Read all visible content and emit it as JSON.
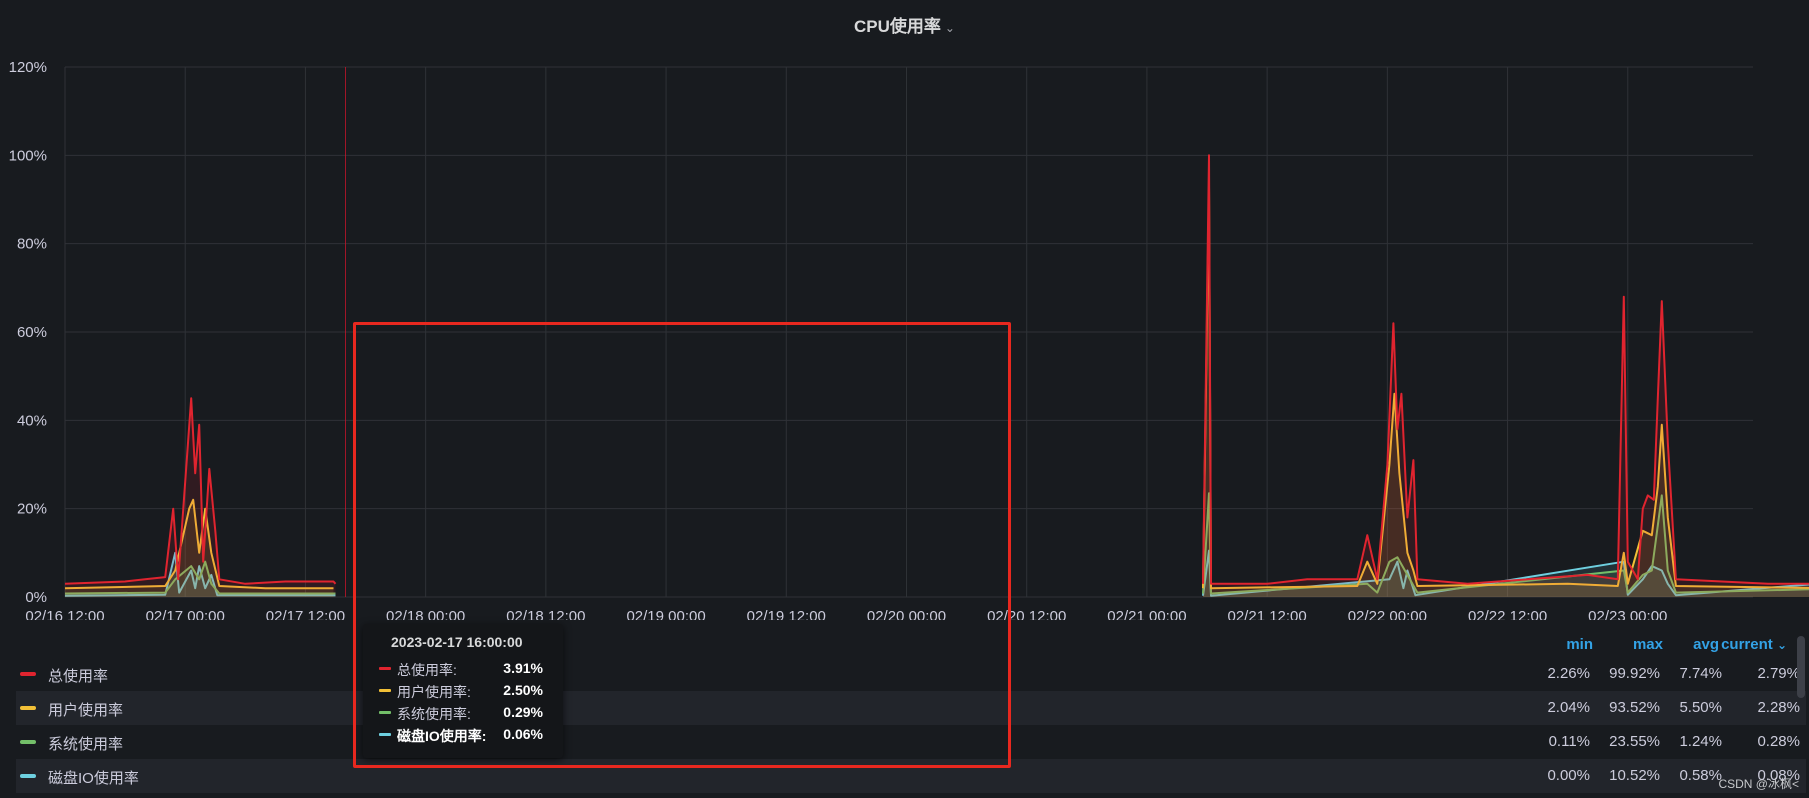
{
  "panel": {
    "title": "CPU使用率"
  },
  "colors": {
    "total": "#e0242f",
    "user": "#f2c037",
    "system": "#73bf69",
    "io": "#6ed0e0",
    "box": "#e8281f"
  },
  "icons": {
    "title_dropdown": "chevron-down-icon",
    "current_sort": "chevron-down-icon"
  },
  "legend": {
    "headers": {
      "min": "min",
      "max": "max",
      "avg": "avg",
      "current": "current"
    },
    "rows": [
      {
        "name": "总使用率",
        "min": "2.26%",
        "max": "99.92%",
        "avg": "7.74%",
        "current": "2.79%"
      },
      {
        "name": "用户使用率",
        "min": "2.04%",
        "max": "93.52%",
        "avg": "5.50%",
        "current": "2.28%"
      },
      {
        "name": "系统使用率",
        "min": "0.11%",
        "max": "23.55%",
        "avg": "1.24%",
        "current": "0.28%"
      },
      {
        "name": "磁盘IO使用率",
        "min": "0.00%",
        "max": "10.52%",
        "avg": "0.58%",
        "current": "0.08%"
      }
    ]
  },
  "tooltip": {
    "time": "2023-02-17 16:00:00",
    "rows": [
      {
        "name": "总使用率:",
        "value": "3.91%"
      },
      {
        "name": "用户使用率:",
        "value": "2.50%"
      },
      {
        "name": "系统使用率:",
        "value": "0.29%"
      },
      {
        "name": "磁盘IO使用率:",
        "value": "0.06%"
      }
    ]
  },
  "watermark": "CSDN @冰枫<",
  "chart_data": {
    "type": "line",
    "title": "CPU使用率",
    "xlabel": "",
    "ylabel": "",
    "ylim": [
      0,
      120
    ],
    "xlim": [
      "02/16 12:00",
      "02/23 12:00"
    ],
    "x_ticks": [
      "02/16 12:00",
      "02/17 00:00",
      "02/17 12:00",
      "02/18 00:00",
      "02/18 12:00",
      "02/19 00:00",
      "02/19 12:00",
      "02/20 00:00",
      "02/20 12:00",
      "02/21 00:00",
      "02/21 12:00",
      "02/22 00:00",
      "02/22 12:00",
      "02/23 00:00"
    ],
    "y_ticks": [
      "0%",
      "20%",
      "40%",
      "60%",
      "80%",
      "100%",
      "120%"
    ],
    "y_tick_values": [
      0,
      20,
      40,
      60,
      80,
      100,
      120
    ],
    "grid": true,
    "legend_placement": "bottom-table",
    "x_unit": "hours since 02/16 12:00",
    "series": [
      {
        "name": "总使用率",
        "points": [
          [
            0,
            3
          ],
          [
            6,
            3.5
          ],
          [
            8,
            4
          ],
          [
            10,
            4.5
          ],
          [
            10.8,
            20
          ],
          [
            11.3,
            4
          ],
          [
            12.6,
            45
          ],
          [
            13,
            28
          ],
          [
            13.4,
            39
          ],
          [
            13.8,
            8
          ],
          [
            14.4,
            29
          ],
          [
            15,
            15
          ],
          [
            15.4,
            4
          ],
          [
            18,
            3
          ],
          [
            22,
            3.5
          ],
          [
            26.8,
            3.5
          ],
          [
            27,
            3
          ],
          [
            27.3,
            null
          ],
          [
            113.5,
            null
          ],
          [
            113.6,
            3
          ],
          [
            114.2,
            100
          ],
          [
            114.4,
            3
          ],
          [
            120,
            3
          ],
          [
            124,
            4
          ],
          [
            129,
            4
          ],
          [
            130,
            14
          ],
          [
            131,
            4
          ],
          [
            132,
            30
          ],
          [
            132.6,
            62
          ],
          [
            133,
            38
          ],
          [
            133.4,
            46
          ],
          [
            134,
            18
          ],
          [
            134.6,
            31
          ],
          [
            135,
            4
          ],
          [
            140,
            3
          ],
          [
            146,
            4
          ],
          [
            152,
            5
          ],
          [
            155,
            4
          ],
          [
            155.6,
            68
          ],
          [
            156,
            8
          ],
          [
            157,
            4
          ],
          [
            157.5,
            20
          ],
          [
            158,
            23
          ],
          [
            158.6,
            22
          ],
          [
            159,
            45
          ],
          [
            159.4,
            67
          ],
          [
            160,
            35
          ],
          [
            160.8,
            4
          ],
          [
            170,
            3
          ],
          [
            176,
            3
          ],
          [
            178,
            3
          ],
          [
            178.5,
            35
          ],
          [
            179,
            4
          ],
          [
            180,
            4
          ],
          [
            180.6,
            40
          ],
          [
            181,
            30
          ],
          [
            181.6,
            53
          ],
          [
            182,
            40
          ],
          [
            182.4,
            12
          ],
          [
            183,
            4
          ],
          [
            186,
            3
          ],
          [
            192,
            3
          ]
        ]
      },
      {
        "name": "用户使用率",
        "points": [
          [
            0,
            2
          ],
          [
            10,
            2.5
          ],
          [
            11,
            6
          ],
          [
            12.4,
            20
          ],
          [
            12.8,
            22
          ],
          [
            13.4,
            10
          ],
          [
            14,
            20
          ],
          [
            14.6,
            10
          ],
          [
            15.4,
            2.5
          ],
          [
            20,
            2
          ],
          [
            26.8,
            2
          ],
          [
            27.2,
            null
          ],
          [
            113.5,
            null
          ],
          [
            113.6,
            2
          ],
          [
            114.2,
            93
          ],
          [
            114.4,
            2
          ],
          [
            129,
            2.5
          ],
          [
            130,
            8
          ],
          [
            131,
            3
          ],
          [
            132.2,
            30
          ],
          [
            132.7,
            46
          ],
          [
            133.2,
            28
          ],
          [
            134,
            10
          ],
          [
            134.6,
            6
          ],
          [
            135,
            2.5
          ],
          [
            150,
            3
          ],
          [
            155,
            2.5
          ],
          [
            155.6,
            10
          ],
          [
            156,
            3
          ],
          [
            157.5,
            15
          ],
          [
            158.4,
            14
          ],
          [
            159,
            25
          ],
          [
            159.4,
            39
          ],
          [
            160,
            18
          ],
          [
            160.8,
            2.5
          ],
          [
            176,
            2
          ],
          [
            178.5,
            8
          ],
          [
            179,
            2.5
          ],
          [
            180.6,
            20
          ],
          [
            181,
            12
          ],
          [
            181.6,
            30
          ],
          [
            182,
            20
          ],
          [
            183,
            2.5
          ],
          [
            192,
            2
          ]
        ]
      },
      {
        "name": "系统使用率",
        "points": [
          [
            0,
            0.8
          ],
          [
            10,
            1
          ],
          [
            11,
            4
          ],
          [
            12.6,
            7
          ],
          [
            13.4,
            4
          ],
          [
            14,
            8
          ],
          [
            14.6,
            3
          ],
          [
            15.4,
            0.8
          ],
          [
            27,
            0.8
          ],
          [
            27.2,
            null
          ],
          [
            113.5,
            null
          ],
          [
            113.6,
            0.8
          ],
          [
            114.2,
            23.5
          ],
          [
            114.4,
            0.8
          ],
          [
            130,
            3
          ],
          [
            131,
            1
          ],
          [
            132.2,
            8
          ],
          [
            133,
            9
          ],
          [
            134,
            5
          ],
          [
            135,
            1
          ],
          [
            155.6,
            6
          ],
          [
            156,
            1
          ],
          [
            157.5,
            5
          ],
          [
            158.4,
            6
          ],
          [
            159.4,
            23
          ],
          [
            160,
            6
          ],
          [
            160.8,
            1
          ],
          [
            178.5,
            2
          ],
          [
            179,
            1
          ],
          [
            180.6,
            7
          ],
          [
            181.6,
            14
          ],
          [
            182,
            8
          ],
          [
            183,
            1
          ],
          [
            192,
            0.8
          ]
        ]
      },
      {
        "name": "磁盘IO使用率",
        "points": [
          [
            0,
            0.3
          ],
          [
            10,
            0.5
          ],
          [
            11,
            10
          ],
          [
            11.4,
            1
          ],
          [
            12.6,
            6
          ],
          [
            13,
            2
          ],
          [
            13.4,
            7
          ],
          [
            14,
            2
          ],
          [
            14.6,
            5
          ],
          [
            15.2,
            0.4
          ],
          [
            27,
            0.4
          ],
          [
            27.2,
            null
          ],
          [
            113.5,
            null
          ],
          [
            113.6,
            0.3
          ],
          [
            114.2,
            10.5
          ],
          [
            114.4,
            0.3
          ],
          [
            132.2,
            4
          ],
          [
            133,
            8
          ],
          [
            133.6,
            2
          ],
          [
            134,
            6
          ],
          [
            134.8,
            0.4
          ],
          [
            155.6,
            8
          ],
          [
            156,
            0.5
          ],
          [
            157.5,
            4
          ],
          [
            158.4,
            7
          ],
          [
            159.4,
            6
          ],
          [
            160,
            3
          ],
          [
            160.8,
            0.4
          ],
          [
            180.6,
            4
          ],
          [
            181.6,
            8
          ],
          [
            182,
            3
          ],
          [
            183,
            0.4
          ],
          [
            192,
            0.3
          ]
        ]
      }
    ]
  }
}
